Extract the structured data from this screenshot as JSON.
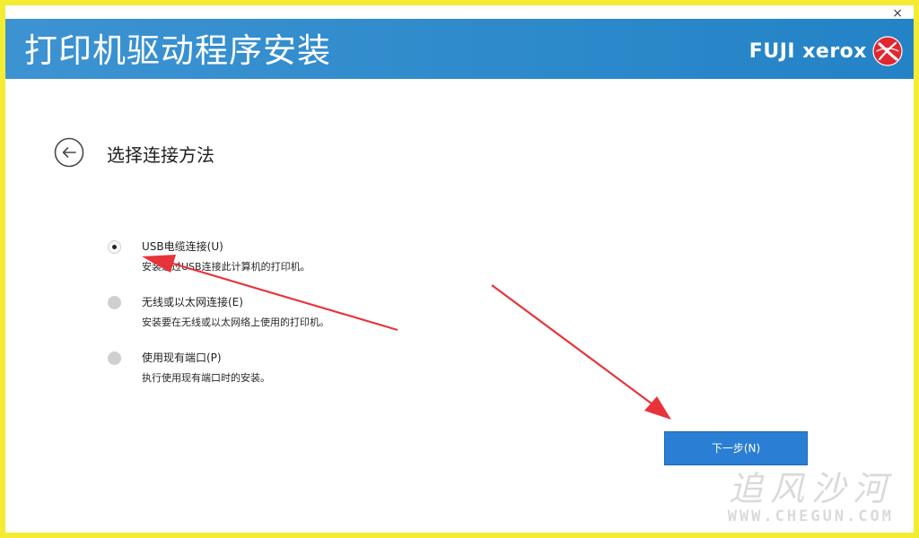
{
  "window": {
    "close_label": "×"
  },
  "header": {
    "title": "打印机驱动程序安装",
    "brand": "FUJI xerox"
  },
  "page": {
    "title": "选择连接方法"
  },
  "options": [
    {
      "label": "USB电缆连接(U)",
      "description": "安装通过USB连接此计算机的打印机。",
      "selected": true
    },
    {
      "label": "无线或以太网连接(E)",
      "description": "安装要在无线或以太网络上使用的打印机。",
      "selected": false
    },
    {
      "label": "使用现有端口(P)",
      "description": "执行使用现有端口时的安装。",
      "selected": false
    }
  ],
  "footer": {
    "next_label": "下一步(N)"
  },
  "watermark": {
    "text": "追风沙河",
    "url": "WWW.CHEGUN.COM"
  },
  "colors": {
    "frame": "#f4ec33",
    "header": "#2e8acb",
    "primary_button": "#2a7fd4",
    "annotation_arrow": "#e8333a",
    "brand_logo": "#e0262f"
  }
}
